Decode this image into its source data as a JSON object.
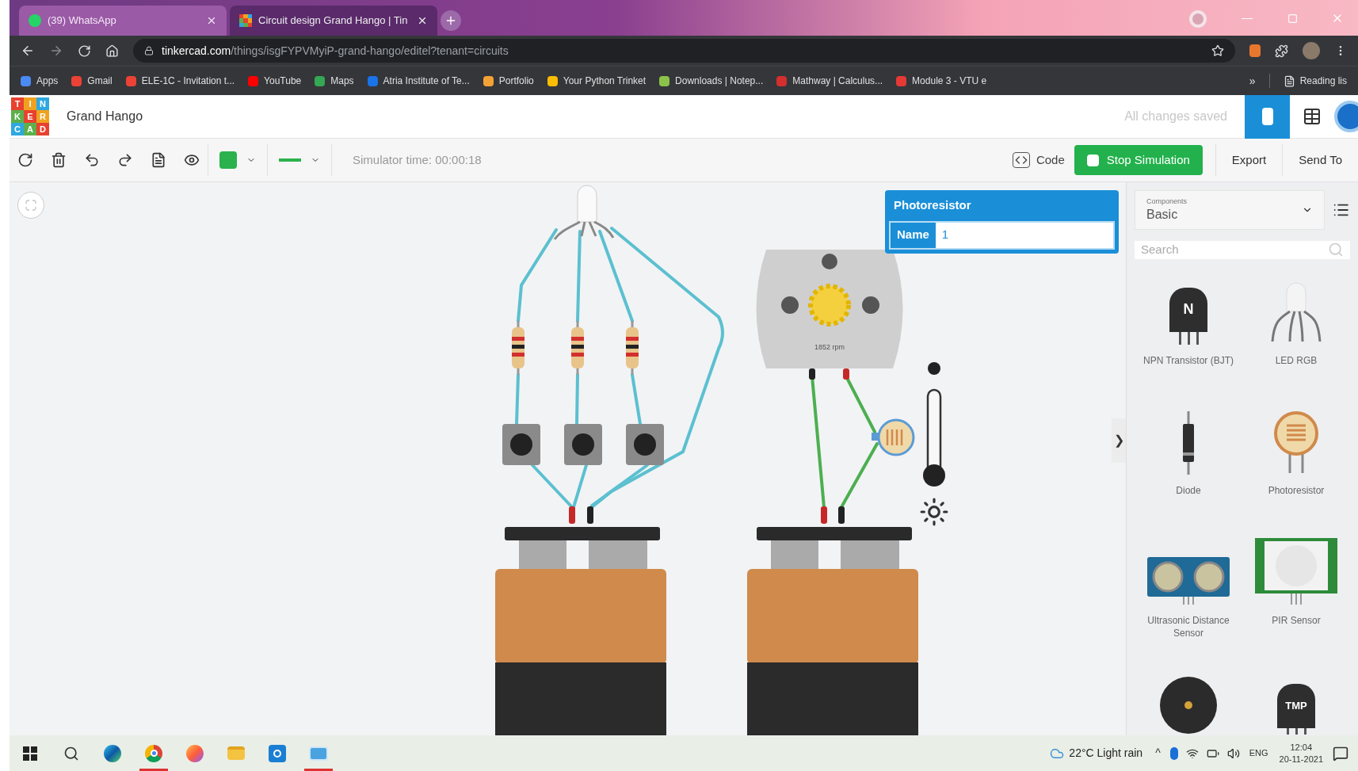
{
  "browser": {
    "tabs": [
      {
        "title": "(39) WhatsApp",
        "kind": "whatsapp",
        "selected": false
      },
      {
        "title": "Circuit design Grand Hango | Tin",
        "kind": "tinkercad",
        "selected": true
      }
    ],
    "url_host": "tinkercad.com",
    "url_path": "/things/isgFYPVMyiP-grand-hango/editel?tenant=circuits",
    "bookmarks": [
      {
        "label": "Apps",
        "color": "#4a8af4"
      },
      {
        "label": "Gmail",
        "color": "#ea4335"
      },
      {
        "label": "ELE-1C - Invitation t...",
        "color": "#ea4335"
      },
      {
        "label": "YouTube",
        "color": "#ff0000"
      },
      {
        "label": "Maps",
        "color": "#34a853"
      },
      {
        "label": "Atria Institute of Te...",
        "color": "#1a73e8"
      },
      {
        "label": "Portfolio",
        "color": "#f4a236"
      },
      {
        "label": "Your Python Trinket",
        "color": "#fbbc04"
      },
      {
        "label": "Downloads | Notep...",
        "color": "#8bc34a"
      },
      {
        "label": "Mathway | Calculus...",
        "color": "#d32f2f"
      },
      {
        "label": "Module 3 - VTU e",
        "color": "#e53935"
      }
    ],
    "more": "»",
    "reading_list": "Reading lis"
  },
  "app": {
    "logo_letters": [
      [
        "T",
        "I",
        "N"
      ],
      [
        "K",
        "E",
        "R"
      ],
      [
        "C",
        "A",
        "D"
      ]
    ],
    "title": "Grand Hango",
    "save_status": "All changes saved"
  },
  "toolbar": {
    "sim_time": "Simulator time: 00:00:18",
    "code": "Code",
    "stop": "Stop Simulation",
    "export": "Export",
    "send_to": "Send To"
  },
  "canvas": {
    "motor_reading": "1852 rpm",
    "popup": {
      "title": "Photoresistor",
      "name_label": "Name",
      "name_value": "1"
    },
    "collapse": "❯"
  },
  "panel": {
    "dropdown_label": "Components",
    "dropdown_value": "Basic",
    "search_placeholder": "Search",
    "components": [
      {
        "kind": "npn",
        "label": "NPN Transistor (BJT)",
        "icon_text": "N"
      },
      {
        "kind": "led_rgb",
        "label": "LED RGB"
      },
      {
        "kind": "diode",
        "label": "Diode"
      },
      {
        "kind": "photoresistor",
        "label": "Photoresistor"
      },
      {
        "kind": "ultrasonic",
        "label": "Ultrasonic Distance Sensor"
      },
      {
        "kind": "pir",
        "label": "PIR Sensor"
      },
      {
        "kind": "buzzer"
      },
      {
        "kind": "tmp",
        "icon_text": "TMP"
      }
    ]
  },
  "taskbar": {
    "apps": [
      {
        "kind": "windows",
        "running": false
      },
      {
        "kind": "search",
        "running": false
      },
      {
        "kind": "edge",
        "running": false
      },
      {
        "kind": "chrome",
        "running": true
      },
      {
        "kind": "firefox",
        "running": false
      },
      {
        "kind": "explorer",
        "running": false
      },
      {
        "kind": "store",
        "running": false
      },
      {
        "kind": "photos",
        "running": true
      }
    ],
    "weather": "22°C  Light rain",
    "caret": "^",
    "lang": "ENG",
    "time": "12:04",
    "date": "20-11-2021"
  }
}
